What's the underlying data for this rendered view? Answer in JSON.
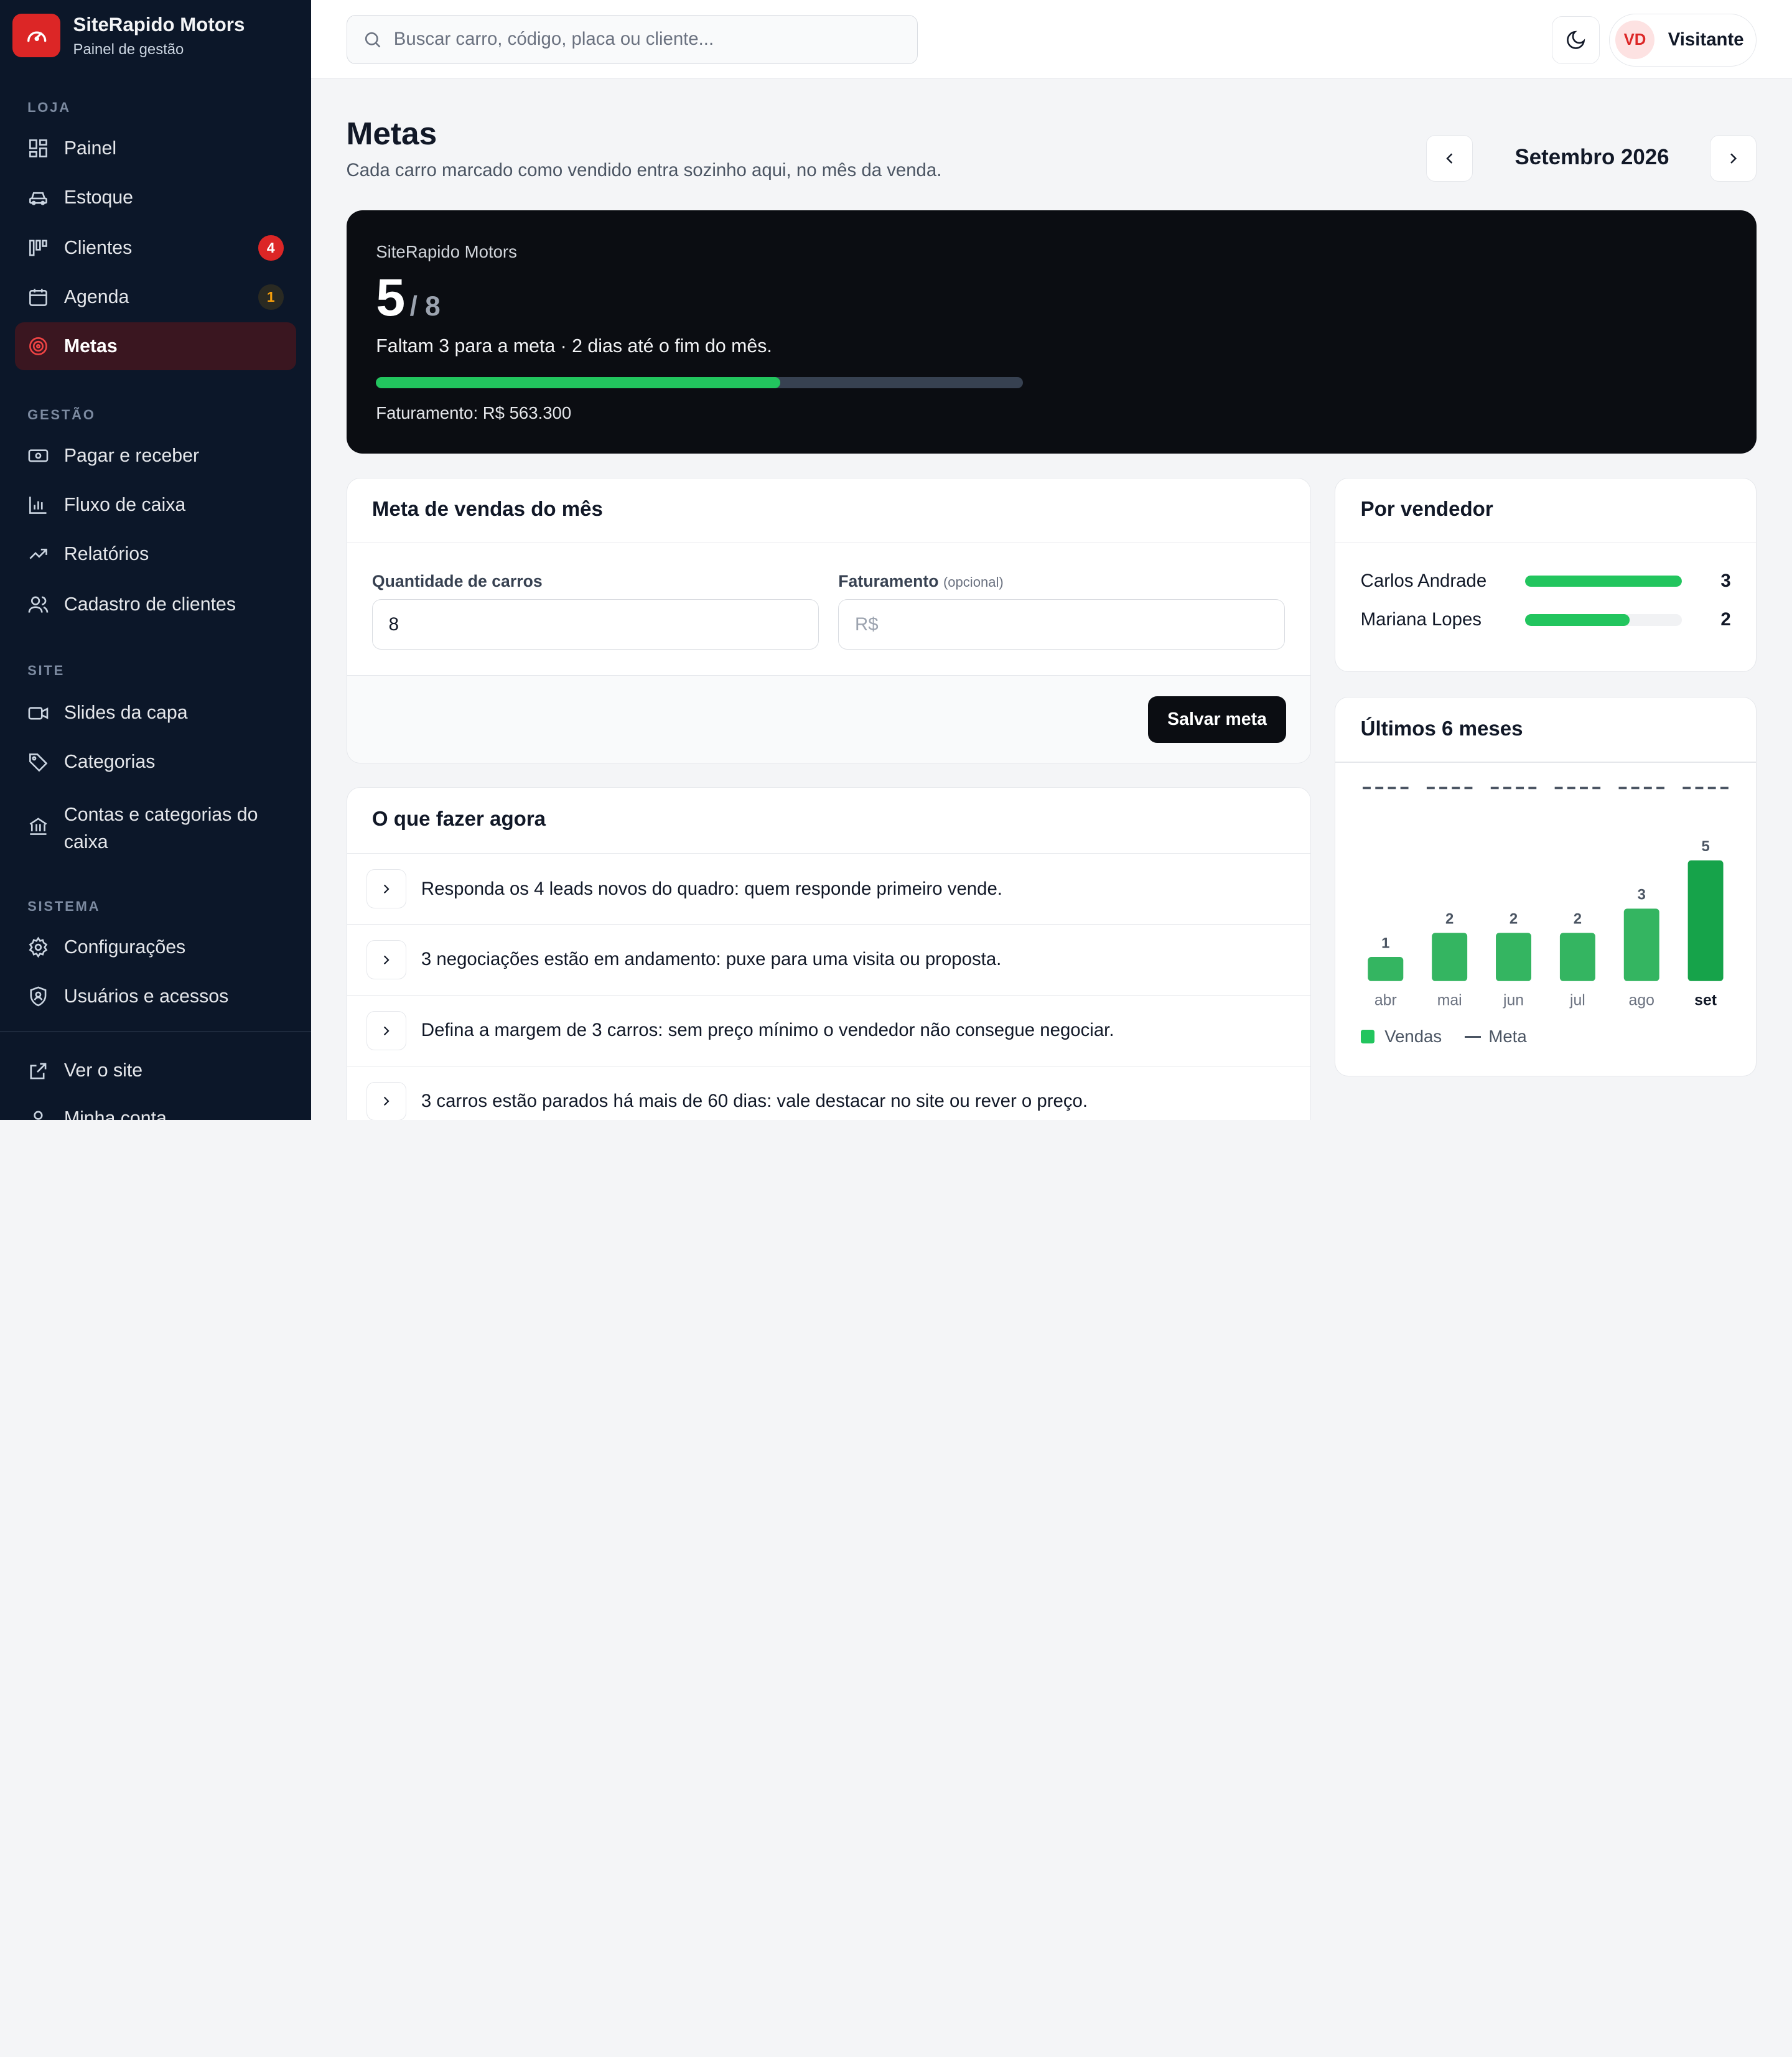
{
  "brand": {
    "name": "SiteRapido Motors",
    "subtitle": "Painel de gestão",
    "accent": "#dc2626"
  },
  "sidebar": {
    "sections": [
      {
        "label": "LOJA"
      },
      {
        "label": "GESTÃO"
      },
      {
        "label": "SITE"
      },
      {
        "label": "SISTEMA"
      }
    ],
    "items": [
      {
        "label": "Painel",
        "icon": "dashboard-icon"
      },
      {
        "label": "Estoque",
        "icon": "car-icon"
      },
      {
        "label": "Clientes",
        "icon": "kanban-icon",
        "badge": "4"
      },
      {
        "label": "Agenda",
        "icon": "calendar-icon",
        "badge": "1"
      },
      {
        "label": "Metas",
        "icon": "target-icon",
        "active": true
      },
      {
        "label": "Pagar e receber",
        "icon": "banknote-icon"
      },
      {
        "label": "Fluxo de caixa",
        "icon": "bar-chart-icon"
      },
      {
        "label": "Relatórios",
        "icon": "trend-icon"
      },
      {
        "label": "Cadastro de clientes",
        "icon": "users-icon"
      },
      {
        "label": "Slides da capa",
        "icon": "video-icon"
      },
      {
        "label": "Categorias",
        "icon": "tag-icon"
      },
      {
        "label": "Contas e categorias do caixa",
        "icon": "bank-icon"
      },
      {
        "label": "Configurações",
        "icon": "gear-icon"
      },
      {
        "label": "Usuários e acessos",
        "icon": "shield-user-icon"
      },
      {
        "label": "Ver o site",
        "icon": "external-link-icon"
      },
      {
        "label": "Minha conta",
        "icon": "user-icon"
      }
    ]
  },
  "topbar": {
    "search_placeholder": "Buscar carro, código, placa ou cliente...",
    "theme_icon": "moon-icon",
    "user": {
      "initials": "VD",
      "name": "Visitante"
    }
  },
  "page": {
    "title": "Metas",
    "subtitle": "Cada carro marcado como vendido entra sozinho aqui, no mês da venda.",
    "month": "Setembro 2026"
  },
  "hero": {
    "store": "SiteRapido Motors",
    "sold": "5",
    "target": "/ 8",
    "message": "Faltam 3 para a meta · 2 dias até o fim do mês.",
    "progress": 0.625,
    "revenue": "Faturamento: R$ 563.300"
  },
  "goal_form": {
    "title": "Meta de vendas do mês",
    "qty_label": "Quantidade de carros",
    "qty_value": "8",
    "revenue_label": "Faturamento",
    "revenue_optional": "(opcional)",
    "revenue_placeholder": "R$",
    "save_label": "Salvar meta"
  },
  "todo": {
    "title": "O que fazer agora",
    "items": [
      "Responda os 4 leads novos do quadro: quem responde primeiro vende.",
      "3 negociações estão em andamento: puxe para uma visita ou proposta.",
      "Defina a margem de 3 carros: sem preço mínimo o vendedor não consegue negociar.",
      "3 carros estão parados há mais de 60 dias: vale destacar no site ou rever o preço."
    ]
  },
  "sellers": {
    "title": "Por vendedor",
    "items": [
      {
        "name": "Carlos Andrade",
        "value": "3",
        "fraction": 1.0
      },
      {
        "name": "Mariana Lopes",
        "value": "2",
        "fraction": 0.667
      }
    ]
  },
  "chart_data": {
    "type": "bar",
    "title": "Últimos 6 meses",
    "categories": [
      "abr",
      "mai",
      "jun",
      "jul",
      "ago",
      "set"
    ],
    "series": [
      {
        "name": "Vendas",
        "values": [
          1,
          2,
          2,
          2,
          3,
          5
        ],
        "color": "#22c55e"
      },
      {
        "name": "Meta",
        "values": [
          8,
          8,
          8,
          8,
          8,
          8
        ],
        "color": "#4b5563"
      }
    ],
    "ylim": [
      0,
      8
    ],
    "highlight_category": "set",
    "legend": "bottom-left",
    "grid": false
  }
}
